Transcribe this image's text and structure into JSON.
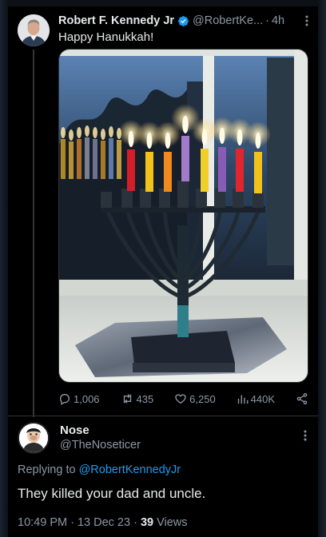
{
  "tweet": {
    "author_name": "Robert F. Kennedy Jr",
    "author_handle": "@RobertKe...",
    "separator": "·",
    "time": "4h",
    "text": "Happy Hanukkah!",
    "photo_icon": "menorah-window-photo",
    "stats": {
      "replies": "1,006",
      "reposts": "435",
      "likes": "6,250",
      "views": "440K"
    }
  },
  "reply": {
    "author_name": "Nose",
    "author_handle": "@TheNoseticer",
    "replying_prefix": "Replying to",
    "replying_to": "@RobertKennedyJr",
    "text": "They killed your dad and uncle.",
    "timestamp": "10:49 PM · 13 Dec 23 · ",
    "views_count": "39",
    "views_label": " Views"
  },
  "colors": {
    "accent": "#1d9bf0",
    "verified": "#1d9bf0",
    "muted": "#8b98a5",
    "text": "#e7e9ea",
    "background": "#000000"
  }
}
